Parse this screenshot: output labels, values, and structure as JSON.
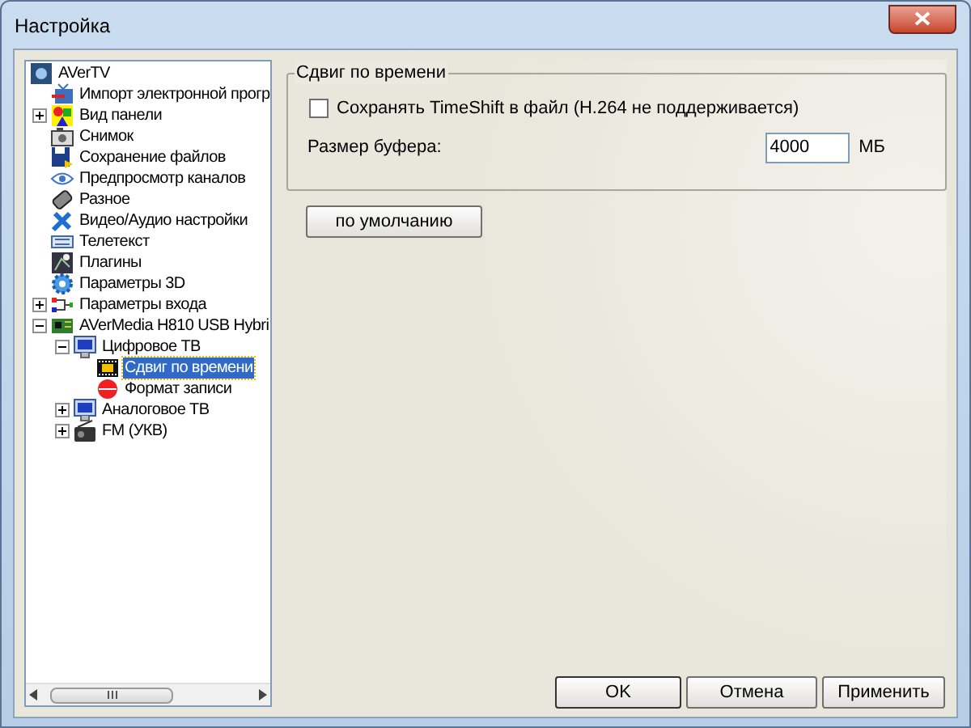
{
  "window": {
    "title": "Настройка"
  },
  "tree": [
    {
      "label": "AVerTV",
      "selected": false,
      "children": [
        {
          "label": "Импорт электронной прогр",
          "selected": false
        },
        {
          "label": "Вид панели",
          "selected": false,
          "expanded": false
        },
        {
          "label": "Снимок",
          "selected": false
        },
        {
          "label": "Сохранение файлов",
          "selected": false
        },
        {
          "label": "Предпросмотр каналов",
          "selected": false
        },
        {
          "label": "Разное",
          "selected": false
        },
        {
          "label": "Видео/Аудио настройки",
          "selected": false
        },
        {
          "label": "Телетекст",
          "selected": false
        },
        {
          "label": "Плагины",
          "selected": false
        },
        {
          "label": "Параметры 3D",
          "selected": false
        },
        {
          "label": "Параметры входа",
          "selected": false,
          "expanded": false
        },
        {
          "label": "AVerMedia H810 USB Hybri",
          "selected": false,
          "expanded": true,
          "children": [
            {
              "label": "Цифровое ТВ",
              "selected": false,
              "expanded": true,
              "children": [
                {
                  "label": "Сдвиг по времени",
                  "selected": true
                },
                {
                  "label": "Формат записи",
                  "selected": false
                }
              ]
            },
            {
              "label": "Аналоговое ТВ",
              "selected": false,
              "expanded": false
            },
            {
              "label": "FM (УКВ)",
              "selected": false,
              "expanded": false
            }
          ]
        }
      ]
    }
  ],
  "group": {
    "title": "Сдвиг по времени",
    "checkbox": {
      "label": "Сохранять TimeShift в файл (H.264 не поддерживается)",
      "checked": false
    },
    "buffer": {
      "label": "Размер буфера:",
      "value": "4000",
      "unit": "МБ"
    }
  },
  "default_button": "по умолчанию",
  "buttons": [
    "OK",
    "Отмена",
    "Применить"
  ]
}
